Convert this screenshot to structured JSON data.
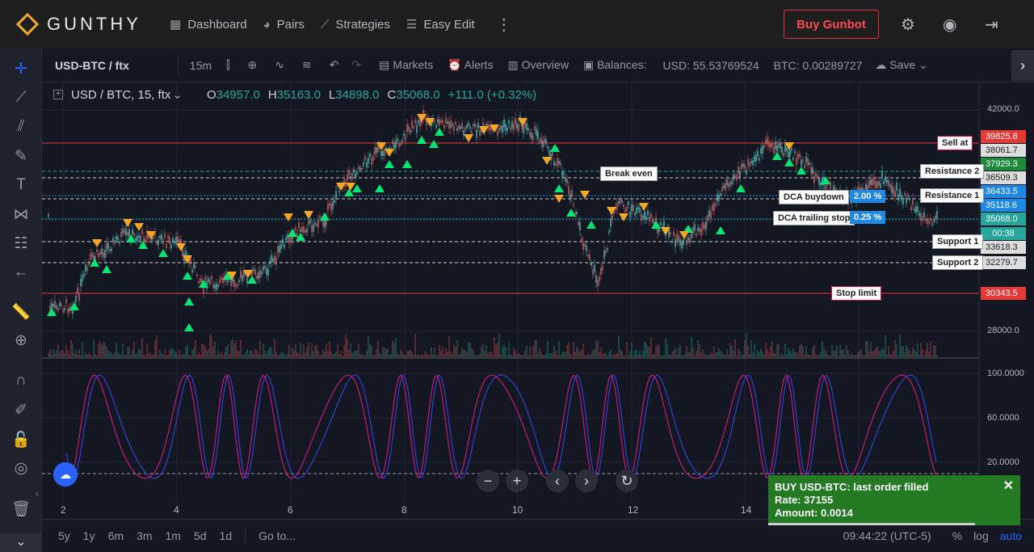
{
  "brand": {
    "name": "GUNTHY"
  },
  "nav": [
    {
      "label": "Dashboard",
      "icon": "dashboard-icon"
    },
    {
      "label": "Pairs",
      "icon": "pairs-icon"
    },
    {
      "label": "Strategies",
      "icon": "strategies-icon"
    },
    {
      "label": "Easy Edit",
      "icon": "easy-edit-icon"
    }
  ],
  "buy_button": "Buy Gunbot",
  "toolbar": {
    "symbol": "USD-BTC / ftx",
    "interval": "15m",
    "markets": "Markets",
    "alerts": "Alerts",
    "overview": "Overview",
    "balances": "Balances:",
    "usd_balance": "USD: 55.53769524",
    "btc_balance": "BTC: 0.00289727",
    "save": "Save"
  },
  "legend": {
    "symbol": "USD / BTC, 15, ftx",
    "o_label": "O",
    "o": "34957.0",
    "h_label": "H",
    "h": "35163.0",
    "l_label": "L",
    "l": "34898.0",
    "c_label": "C",
    "c": "35068.0",
    "change": "+111.0 (+0.32%)"
  },
  "price_axis": [
    "42000.0",
    "28000.0"
  ],
  "osc_axis": [
    "100.0000",
    "60.0000",
    "20.0000"
  ],
  "time_axis": [
    "2",
    "4",
    "6",
    "8",
    "10",
    "12",
    "14"
  ],
  "levels": {
    "sell_at": {
      "label": "Sell at",
      "price": "39825.8",
      "color": "#e53935"
    },
    "resistance2": {
      "label": "Resistance 2",
      "price": "37929.3",
      "color": "#1b8a3a"
    },
    "p38061": {
      "price": "38061.7"
    },
    "p36509": {
      "price": "36509.3"
    },
    "break_even": {
      "label": "Break even"
    },
    "dca_buydown": {
      "label": "DCA buydown",
      "pct": "2.00 %",
      "price": "36433.5"
    },
    "resistance1": {
      "label": "Resistance 1",
      "price": "35118.6"
    },
    "dca_trailing": {
      "label": "DCA trailing stop",
      "pct": "0.25 %"
    },
    "current": {
      "price": "35068.0",
      "countdown": "00:38",
      "color": "#26a69a"
    },
    "support1": {
      "label": "Support 1",
      "price": "33618.3"
    },
    "support2": {
      "label": "Support 2",
      "price": "32279.7"
    },
    "stop_limit": {
      "label": "Stop limit",
      "price": "30343.5",
      "color": "#e53935"
    }
  },
  "ranges": [
    "5y",
    "1y",
    "6m",
    "3m",
    "1m",
    "5d",
    "1d"
  ],
  "goto": "Go to...",
  "clock": "09:44:22 (UTC-5)",
  "scale_opts": [
    "%",
    "log",
    "auto"
  ],
  "toast": {
    "title": "BUY USD-BTC: last order filled",
    "rate": "Rate: 37155",
    "amount": "Amount: 0.0014",
    "progress": 0.82
  }
}
